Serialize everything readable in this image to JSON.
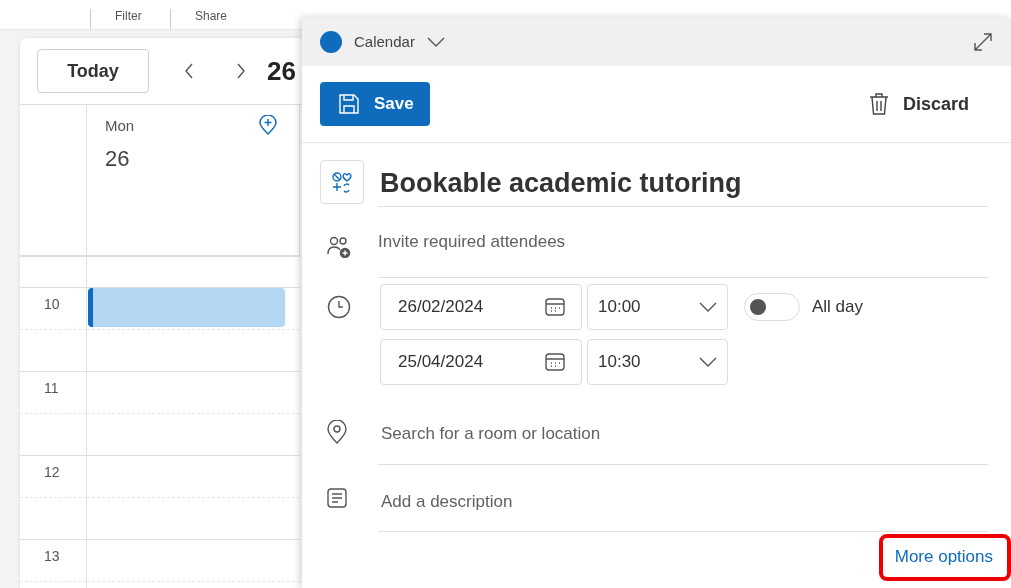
{
  "toolbar": {
    "items": [
      "Filter",
      "Share"
    ]
  },
  "calendar": {
    "today_button": "Today",
    "date_heading": "26",
    "day": {
      "weekday": "Mon",
      "date": "26"
    },
    "hours": [
      "10",
      "11",
      "12",
      "13"
    ]
  },
  "event_editor": {
    "calendar": {
      "name": "Calendar",
      "color": "#0f6cbd"
    },
    "save": "Save",
    "discard": "Discard",
    "title": "Bookable academic tutoring",
    "attendees": {
      "placeholder": "Invite required attendees"
    },
    "start": {
      "date": "26/02/2024",
      "time": "10:00"
    },
    "end": {
      "date": "25/04/2024",
      "time": "10:30"
    },
    "all_day": {
      "label": "All day",
      "on": false
    },
    "location": {
      "placeholder": "Search for a room or location"
    },
    "description": {
      "placeholder": "Add a description"
    },
    "more_options": {
      "label": "More options",
      "highlighted": true
    }
  }
}
